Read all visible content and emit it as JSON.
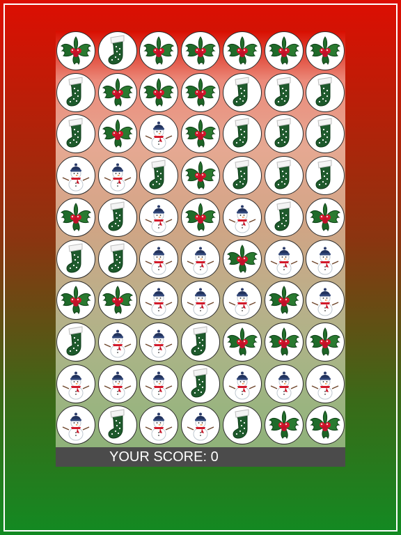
{
  "game": {
    "score_label": "YOUR SCORE: 0",
    "colors": {
      "background_top": "#dd0e02",
      "background_bottom": "#128a22",
      "score_bar": "#4b4b4b",
      "tile_fill": "#ffffff"
    },
    "grid": {
      "rows": 10,
      "cols": 7,
      "tiles": [
        [
          "holly-icon",
          "stocking-icon",
          "holly-icon",
          "holly-icon",
          "holly-icon",
          "holly-icon",
          "holly-icon"
        ],
        [
          "stocking-icon",
          "holly-icon",
          "holly-icon",
          "holly-icon",
          "stocking-icon",
          "stocking-icon",
          "stocking-icon"
        ],
        [
          "stocking-icon",
          "holly-icon",
          "snowman-icon",
          "holly-icon",
          "stocking-icon",
          "stocking-icon",
          "stocking-icon"
        ],
        [
          "snowman-icon",
          "snowman-icon",
          "stocking-icon",
          "holly-icon",
          "stocking-icon",
          "stocking-icon",
          "stocking-icon"
        ],
        [
          "holly-icon",
          "stocking-icon",
          "snowman-icon",
          "holly-icon",
          "snowman-icon",
          "stocking-icon",
          "holly-icon"
        ],
        [
          "stocking-icon",
          "stocking-icon",
          "snowman-icon",
          "snowman-icon",
          "holly-icon",
          "snowman-icon",
          "snowman-icon"
        ],
        [
          "holly-icon",
          "holly-icon",
          "snowman-icon",
          "snowman-icon",
          "snowman-icon",
          "holly-icon",
          "snowman-icon"
        ],
        [
          "stocking-icon",
          "snowman-icon",
          "snowman-icon",
          "stocking-icon",
          "holly-icon",
          "holly-icon",
          "holly-icon"
        ],
        [
          "snowman-icon",
          "snowman-icon",
          "snowman-icon",
          "stocking-icon",
          "snowman-icon",
          "snowman-icon",
          "snowman-icon"
        ],
        [
          "snowman-icon",
          "stocking-icon",
          "snowman-icon",
          "snowman-icon",
          "stocking-icon",
          "holly-icon",
          "holly-icon"
        ]
      ]
    }
  }
}
